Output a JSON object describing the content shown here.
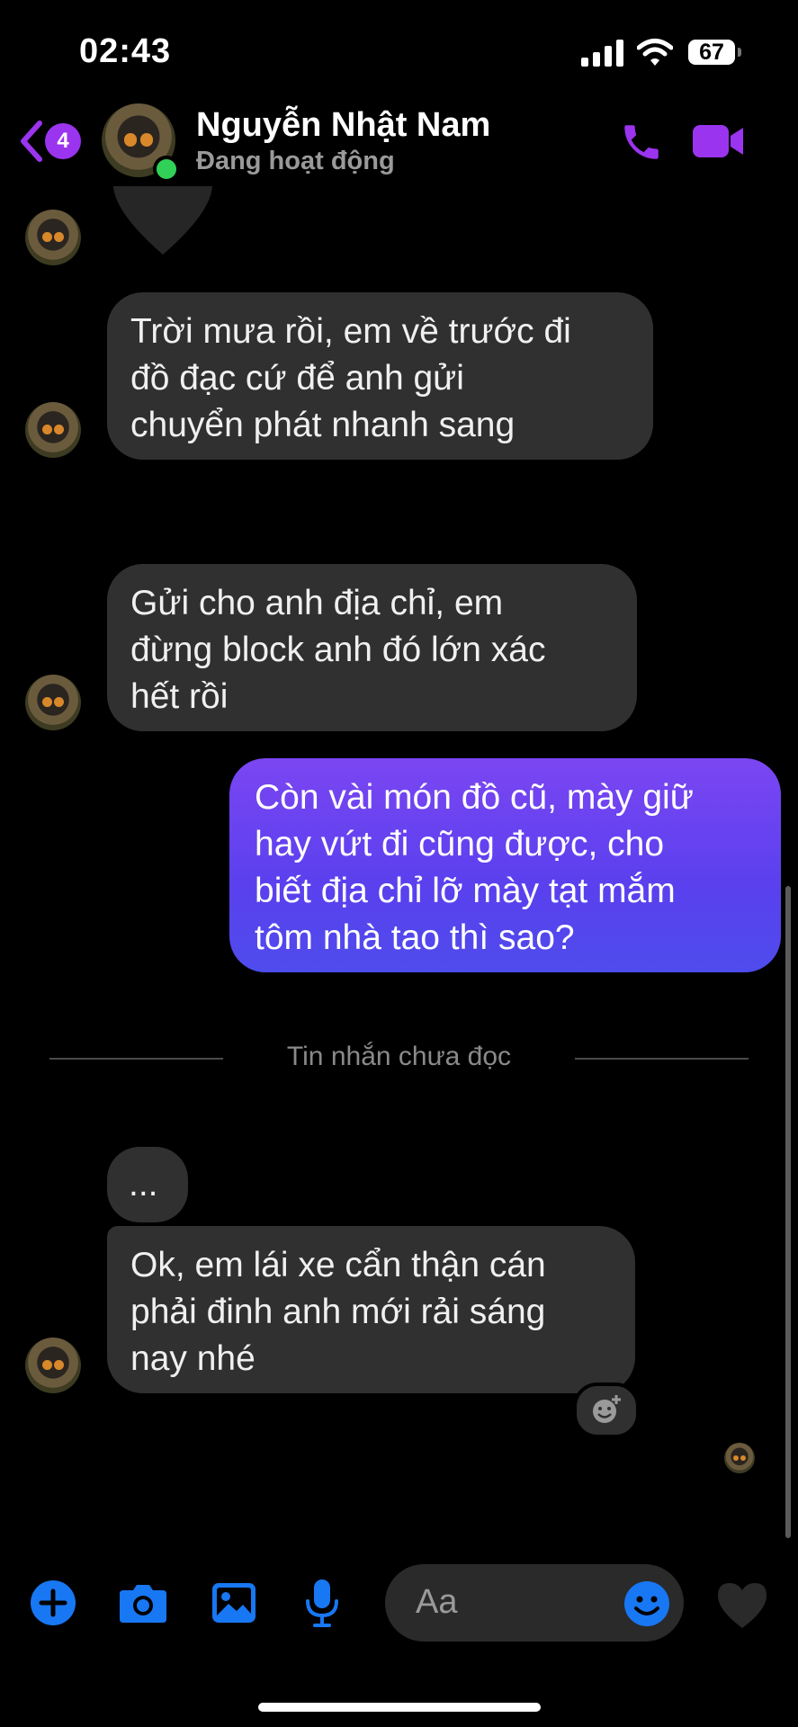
{
  "status_bar": {
    "time": "02:43",
    "battery": "67"
  },
  "header": {
    "back_badge": "4",
    "contact_name": "Nguyễn Nhật Nam",
    "contact_status": "Đang hoạt động"
  },
  "messages": [
    {
      "direction": "in",
      "text": "Trời mưa rồi, em về trước đi\nđồ đạc cứ để anh gửi\nchuyển phát nhanh sang"
    },
    {
      "direction": "in",
      "text": "Gửi cho anh địa chỉ, em\nđừng block anh đó lớn xác\nhết rồi"
    },
    {
      "direction": "out",
      "text": "Còn vài món đồ cũ, mày giữ\nhay vứt đi cũng được, cho\nbiết địa chỉ lỡ mày tạt mắm\ntôm nhà tao thì sao?"
    },
    {
      "direction": "in",
      "text": "..."
    },
    {
      "direction": "in",
      "text": "Ok, em lái xe cẩn thận cán\nphải đinh anh mới rải sáng\nnay nhé"
    }
  ],
  "divider": {
    "label": "Tin nhắn chưa đọc"
  },
  "composer": {
    "placeholder": "Aa"
  },
  "colors": {
    "accent": "#9b34ef",
    "outgoing_bubble": "#5a40ee",
    "incoming_bubble": "#303030",
    "composer_icons": "#1877f2"
  },
  "icons": [
    "back-chevron-icon",
    "phone-icon",
    "video-call-icon",
    "plus-icon",
    "camera-icon",
    "gallery-icon",
    "microphone-icon",
    "emoji-icon",
    "heart-icon",
    "add-reaction-icon"
  ]
}
